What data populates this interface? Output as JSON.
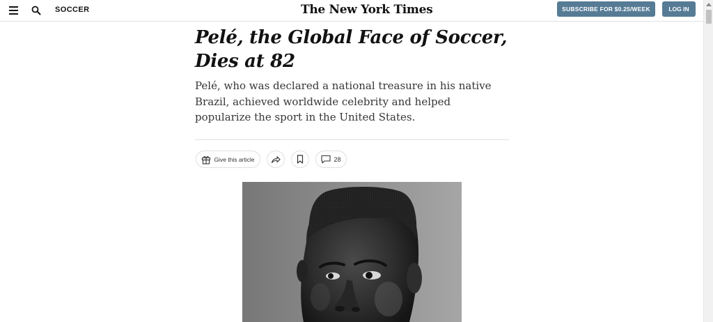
{
  "header": {
    "section": "SOCCER",
    "logo": "The New York Times",
    "subscribe_label": "SUBSCRIBE FOR $0.25/WEEK",
    "login_label": "LOG IN",
    "menu_icon": "hamburger-menu-icon",
    "search_icon": "search-icon",
    "accent_color": "#567b95"
  },
  "article": {
    "headline": "Pelé, the Global Face of Soccer, Dies at 82",
    "summary": "Pelé, who was declared a national treasure in his native Brazil, achieved worldwide celebrity and helped popularize the sport in the United States.",
    "actions": {
      "gift_label": "Give this article",
      "gift_icon": "gift-icon",
      "share_icon": "share-arrow-icon",
      "save_icon": "bookmark-icon",
      "comment_icon": "comment-bubble-icon",
      "comment_count": "28"
    }
  }
}
